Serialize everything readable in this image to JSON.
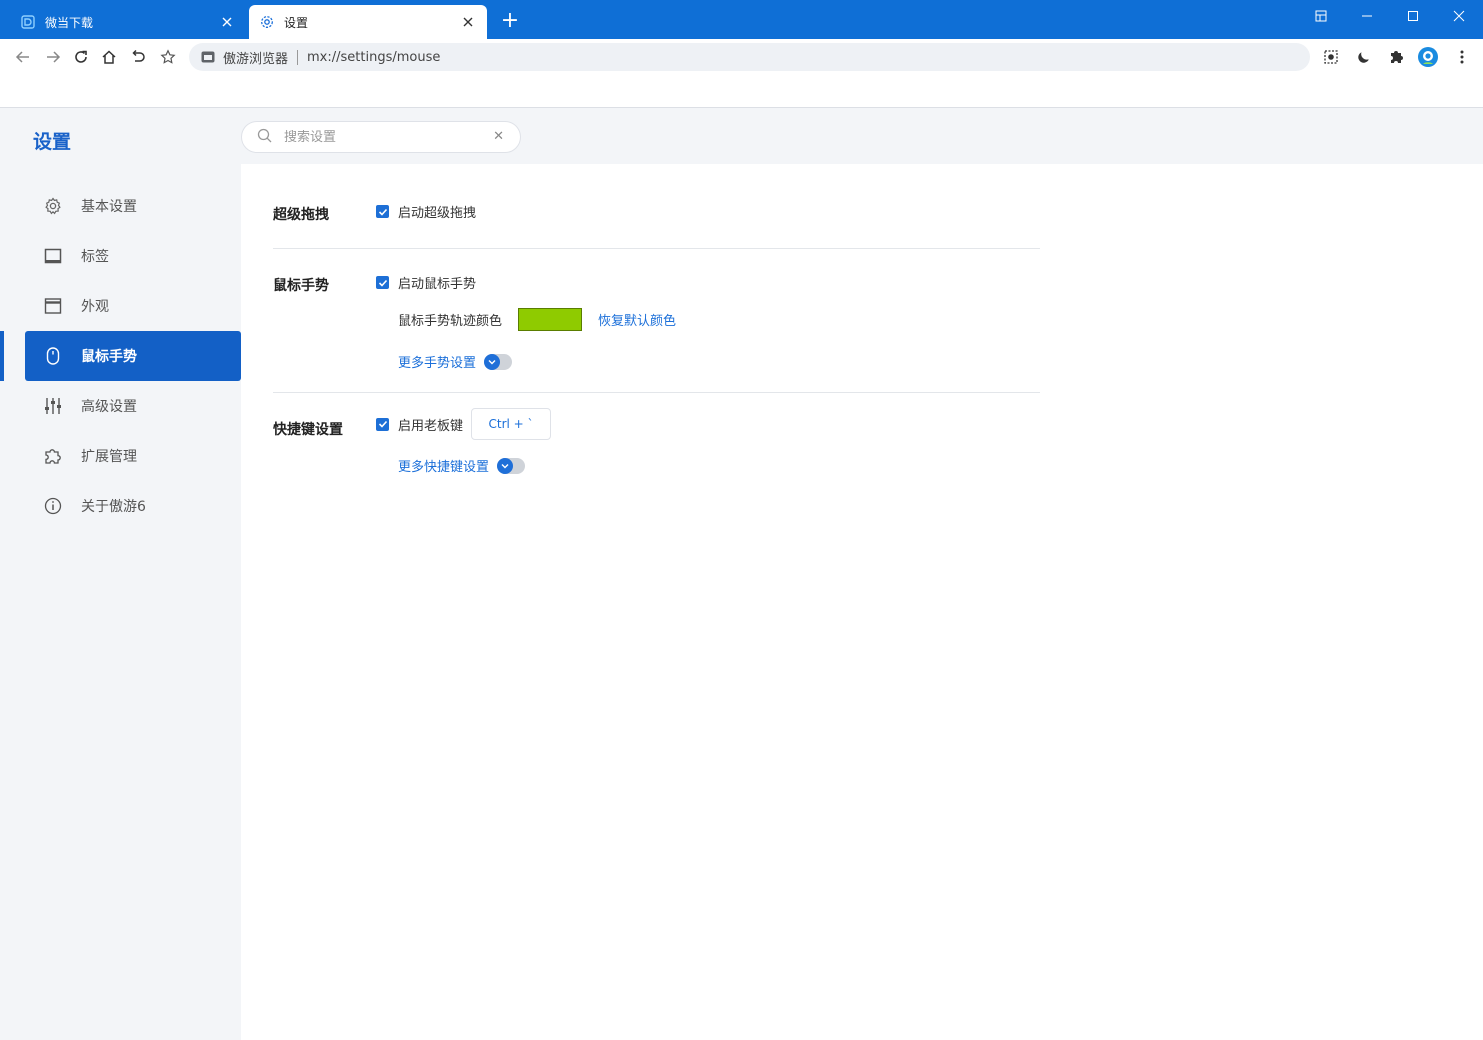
{
  "tabs": [
    {
      "title": "微当下载",
      "icon": "weidown-logo-icon",
      "active": false
    },
    {
      "title": "设置",
      "icon": "gear-icon",
      "active": true
    }
  ],
  "window_controls": [
    "pin-icon",
    "minimize-icon",
    "maximize-icon",
    "close-icon"
  ],
  "address_bar": {
    "site_name": "傲游浏览器",
    "url": "mx://settings/mouse"
  },
  "sidebar": {
    "title": "设置",
    "items": [
      {
        "label": "基本设置",
        "icon": "gear-icon"
      },
      {
        "label": "标签",
        "icon": "tab-icon"
      },
      {
        "label": "外观",
        "icon": "appearance-icon"
      },
      {
        "label": "鼠标手势",
        "icon": "mouse-icon"
      },
      {
        "label": "高级设置",
        "icon": "sliders-icon"
      },
      {
        "label": "扩展管理",
        "icon": "puzzle-icon"
      },
      {
        "label": "关于傲游6",
        "icon": "info-icon"
      }
    ],
    "active_index": 3
  },
  "search": {
    "placeholder": "搜索设置",
    "value": ""
  },
  "sections": {
    "super_drag": {
      "title": "超级拖拽",
      "enable_label": "启动超级拖拽",
      "checked": true
    },
    "mouse_gesture": {
      "title": "鼠标手势",
      "enable_label": "启动鼠标手势",
      "checked": true,
      "trail_color_label": "鼠标手势轨迹颜色",
      "trail_color": "#8fcb00",
      "restore_label": "恢复默认颜色",
      "more_label": "更多手势设置"
    },
    "shortcut": {
      "title": "快捷键设置",
      "boss_key_label": "启用老板键",
      "checked": true,
      "boss_key_value": "Ctrl + `",
      "more_label": "更多快捷键设置"
    }
  },
  "colors": {
    "accent": "#1360c6",
    "titlebar": "#0f6fd6",
    "link": "#1b6fd9"
  }
}
